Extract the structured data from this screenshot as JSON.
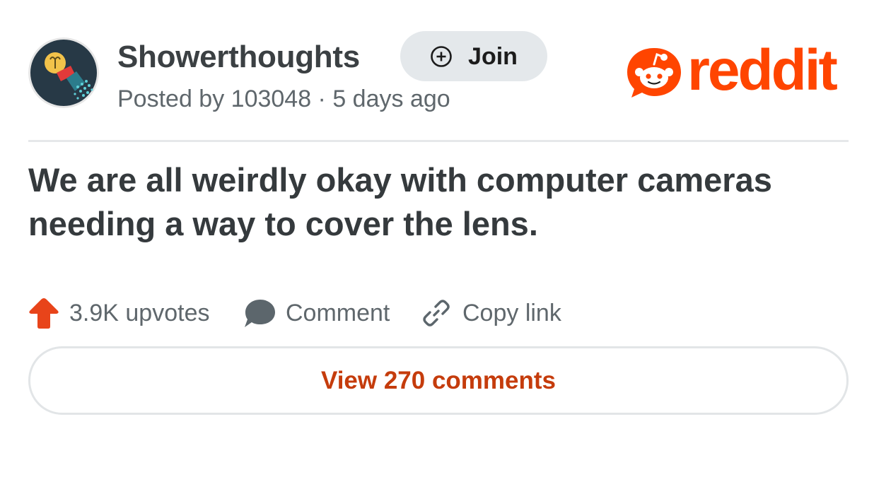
{
  "header": {
    "subreddit": "Showerthoughts",
    "join_label": "Join",
    "posted_by": "Posted by 103048 · 5 days ago",
    "logo_text": "reddit"
  },
  "post": {
    "title": "We are all weirdly okay with computer cameras needing a way to cover the lens."
  },
  "actions": {
    "upvotes_label": "3.9K upvotes",
    "comment_label": "Comment",
    "copy_link_label": "Copy link"
  },
  "footer": {
    "view_comments_label": "View 270 comments"
  },
  "colors": {
    "brand": "#ff4500",
    "accent_text": "#c53c0c",
    "muted_text": "#5f676c",
    "join_bg": "#e4e8eb"
  },
  "icons": {
    "avatar": "lightbulb-shower-icon",
    "join": "plus-circle-icon",
    "logo": "reddit-snoo-icon",
    "upvote": "upvote-arrow-icon",
    "comment": "comment-bubble-icon",
    "copy": "link-chain-icon"
  }
}
